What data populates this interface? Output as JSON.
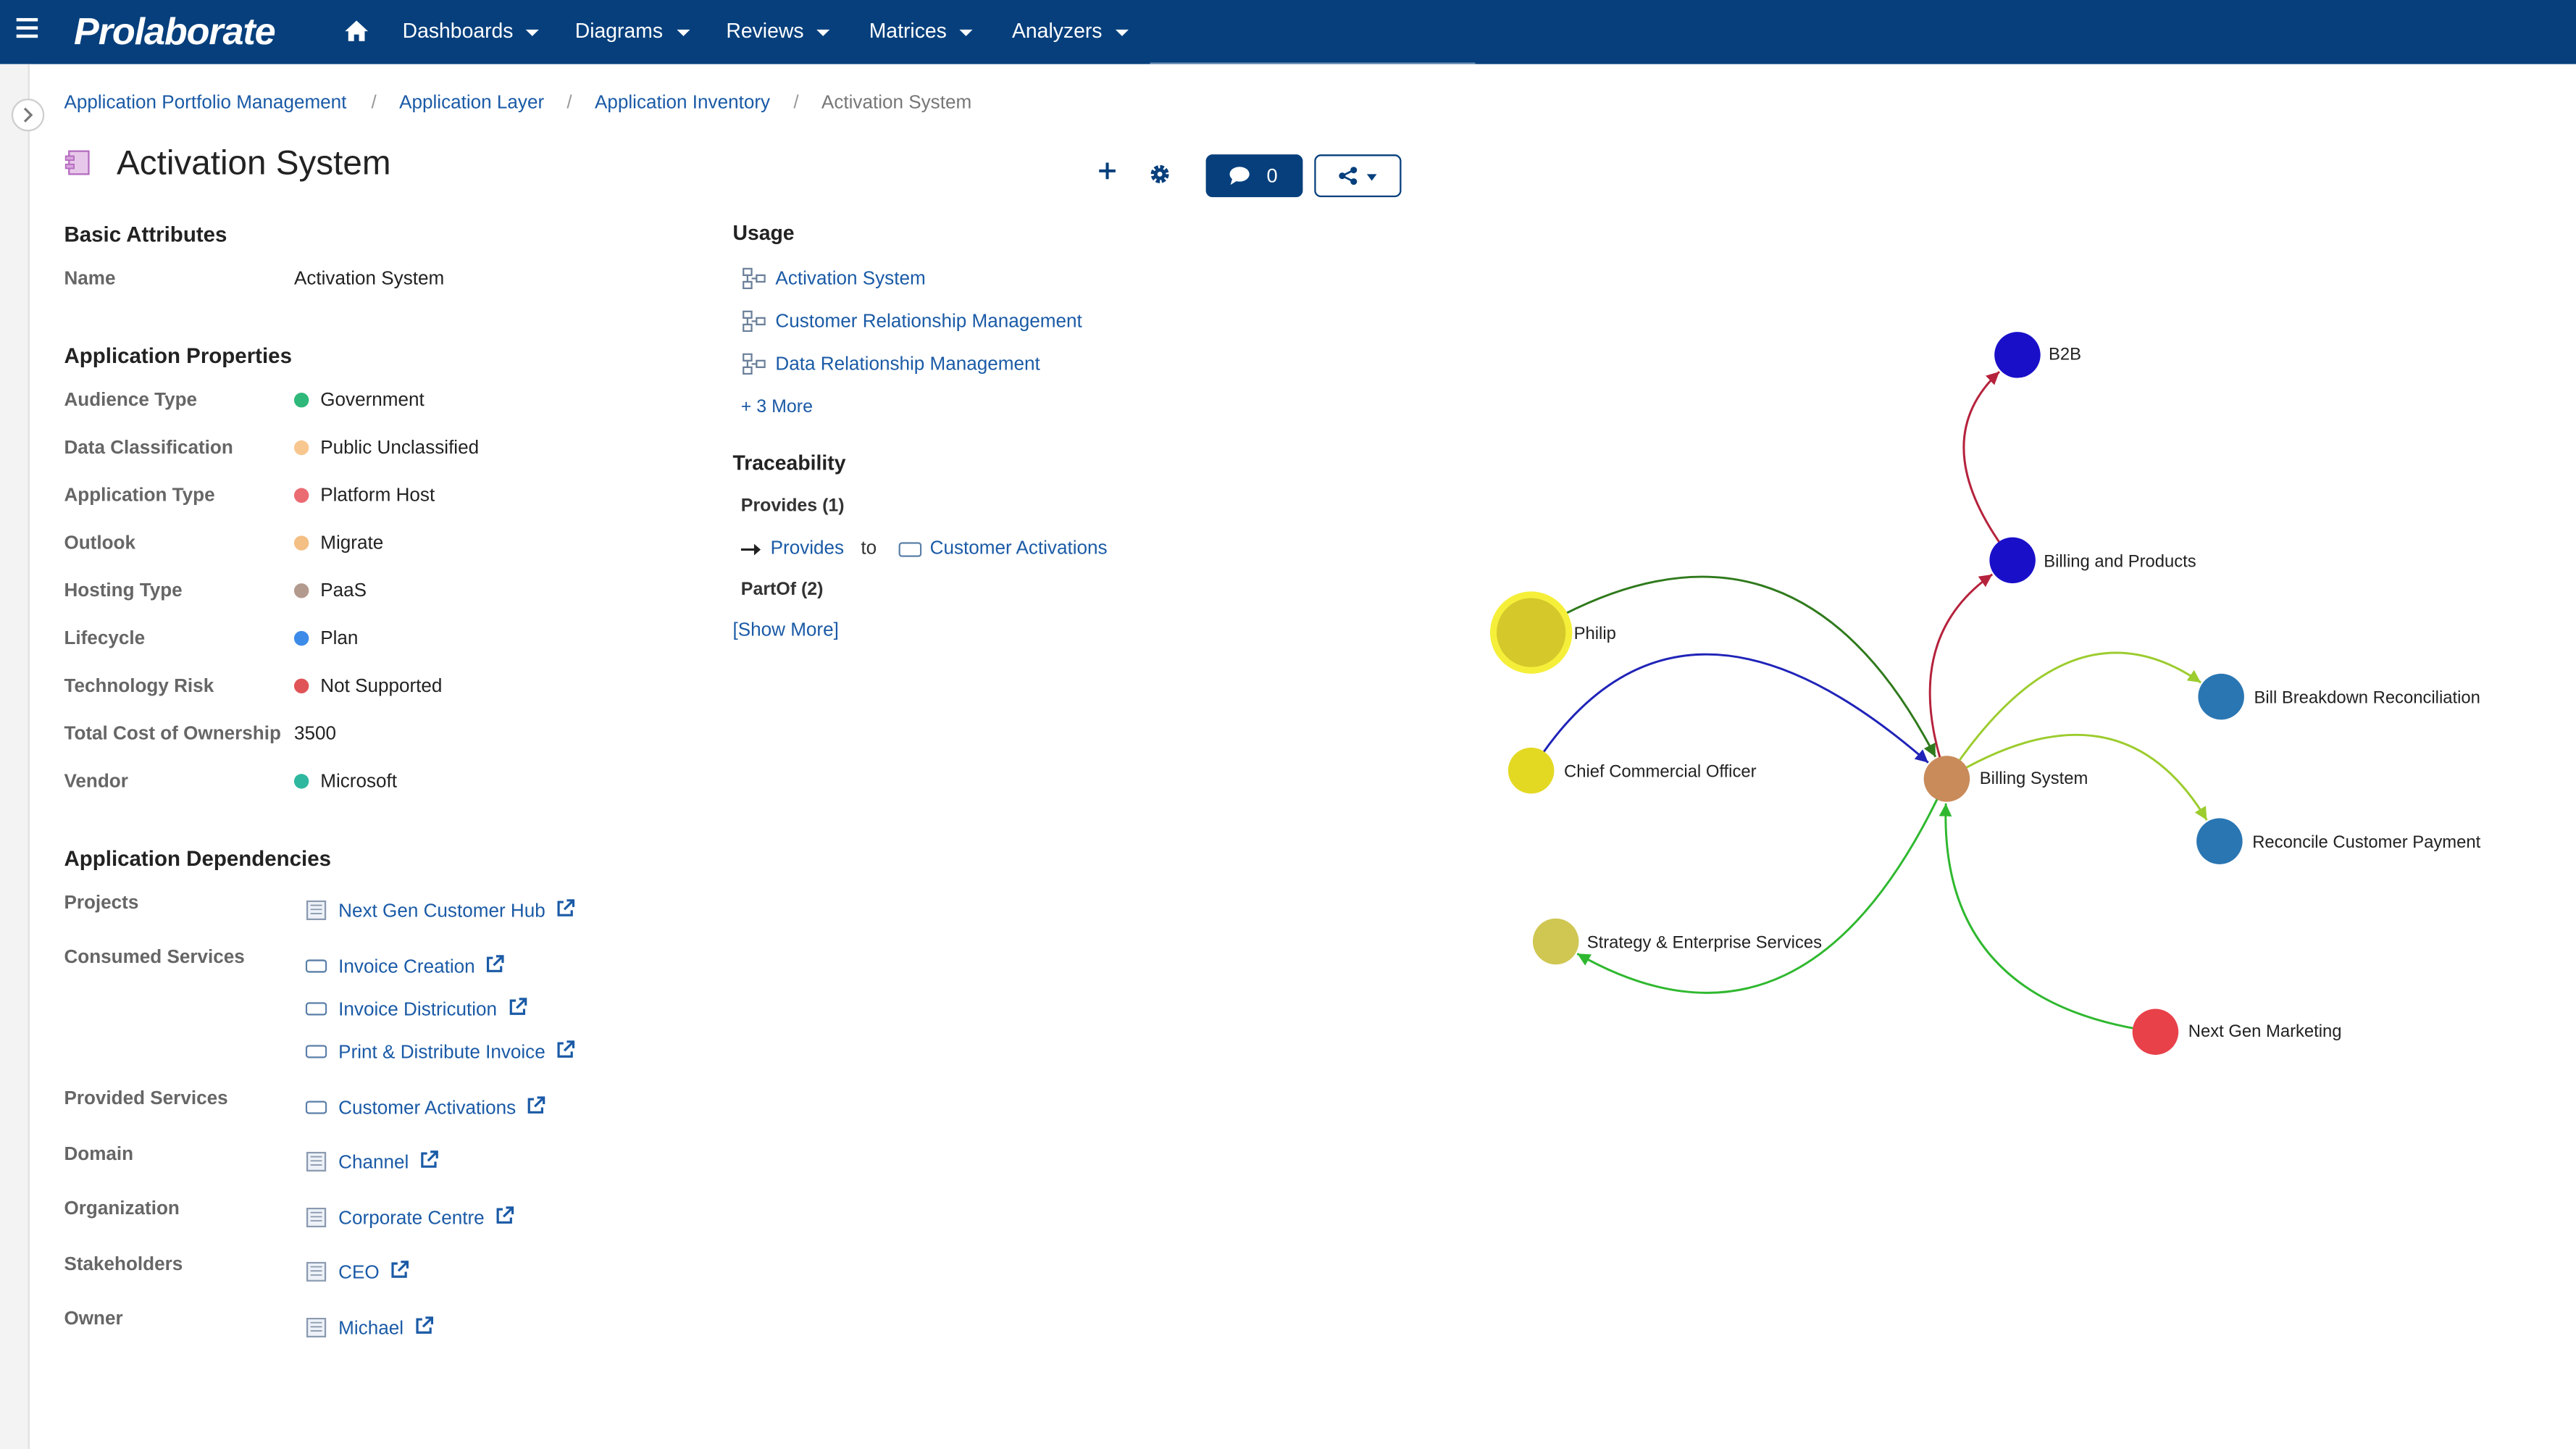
{
  "app": {
    "logo": "Prolaborate",
    "menu": [
      "Dashboards",
      "Diagrams",
      "Reviews",
      "Matrices",
      "Analyzers"
    ]
  },
  "breadcrumb": {
    "items": [
      "Application Portfolio Management",
      "Application Layer",
      "Application Inventory"
    ],
    "current": "Activation System",
    "separator": "/"
  },
  "header": {
    "title": "Activation System",
    "comment_count": "0"
  },
  "basic": {
    "title": "Basic Attributes",
    "name_label": "Name",
    "name_value": "Activation System"
  },
  "props": {
    "title": "Application Properties",
    "rows": [
      {
        "label": "Audience Type",
        "value": "Government",
        "color": "#2eb87a"
      },
      {
        "label": "Data Classification",
        "value": "Public Unclassified",
        "color": "#f8c78f"
      },
      {
        "label": "Application Type",
        "value": "Platform Host",
        "color": "#eb6b73"
      },
      {
        "label": "Outlook",
        "value": "Migrate",
        "color": "#f3bf84"
      },
      {
        "label": "Hosting Type",
        "value": "PaaS",
        "color": "#b39a8f"
      },
      {
        "label": "Lifecycle",
        "value": "Plan",
        "color": "#3d8be8"
      },
      {
        "label": "Technology Risk",
        "value": "Not Supported",
        "color": "#e05458"
      }
    ],
    "tco_label": "Total Cost of Ownership",
    "tco_value": "3500",
    "vendor_label": "Vendor",
    "vendor_value": "Microsoft",
    "vendor_color": "#2eb8a0"
  },
  "deps": {
    "title": "Application Dependencies",
    "projects_label": "Projects",
    "projects": [
      "Next Gen Customer Hub"
    ],
    "consumed_label": "Consumed Services",
    "consumed": [
      "Invoice Creation",
      "Invoice Districution",
      "Print & Distribute Invoice"
    ],
    "provided_label": "Provided Services",
    "provided": [
      "Customer Activations"
    ],
    "domain_label": "Domain",
    "domain": [
      "Channel"
    ],
    "org_label": "Organization",
    "org": [
      "Corporate Centre"
    ],
    "stake_label": "Stakeholders",
    "stake": [
      "CEO"
    ],
    "owner_label": "Owner",
    "owner": [
      "Michael"
    ]
  },
  "usage": {
    "title": "Usage",
    "items": [
      "Activation System",
      "Customer Relationship Management",
      "Data Relationship Management"
    ],
    "more": "+ 3 More"
  },
  "trace": {
    "title": "Traceability",
    "provides_header": "Provides (1)",
    "provides_rel": "Provides",
    "provides_to": "to",
    "provides_target": "Customer Activations",
    "partof_header": "PartOf (2)",
    "show_more": "[Show More]"
  },
  "graph": {
    "nodes": [
      {
        "id": "b2b",
        "label": "B2B",
        "color": "#1a0fc9"
      },
      {
        "id": "billprod",
        "label": "Billing and Products",
        "color": "#1a0fc9"
      },
      {
        "id": "philip",
        "label": "Philip",
        "color": "#d4c82a"
      },
      {
        "id": "bbr",
        "label": "Bill Breakdown Reconciliation",
        "color": "#2a76b3"
      },
      {
        "id": "cco",
        "label": "Chief Commercial Officer",
        "color": "#e3d923"
      },
      {
        "id": "billsys",
        "label": "Billing System",
        "color": "#c98b5a"
      },
      {
        "id": "rcp",
        "label": "Reconcile Customer Payment",
        "color": "#2a76b3"
      },
      {
        "id": "ses",
        "label": "Strategy & Enterprise Services",
        "color": "#cfc752"
      },
      {
        "id": "ngm",
        "label": "Next Gen Marketing",
        "color": "#e8414a"
      }
    ],
    "edges": [
      {
        "from": "billprod",
        "to": "b2b",
        "color": "#b5223c"
      },
      {
        "from": "billsys",
        "to": "billprod",
        "color": "#b5223c"
      },
      {
        "from": "philip",
        "to": "billsys",
        "color": "#2f7a1c"
      },
      {
        "from": "cco",
        "to": "billsys",
        "color": "#1f23b8"
      },
      {
        "from": "billsys",
        "to": "bbr",
        "color": "#9ccc2e"
      },
      {
        "from": "billsys",
        "to": "rcp",
        "color": "#9ccc2e"
      },
      {
        "from": "billsys",
        "to": "ses",
        "color": "#2fb82f"
      },
      {
        "from": "ngm",
        "to": "billsys",
        "color": "#2fb82f"
      }
    ]
  }
}
